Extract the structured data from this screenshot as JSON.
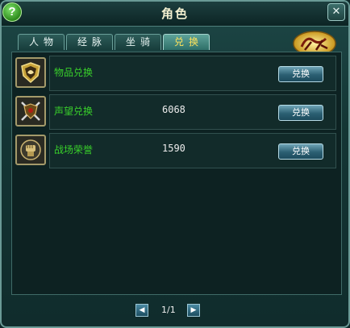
{
  "window": {
    "title": "角色"
  },
  "tabs": [
    {
      "label": "人物"
    },
    {
      "label": "经脉"
    },
    {
      "label": "坐骑"
    },
    {
      "label": "兑换",
      "active": true
    }
  ],
  "logo_icon": "battle-emblem-icon",
  "rows": [
    {
      "label": "物品兑换",
      "value": "",
      "button": "兑换",
      "icon": "item-shield-icon"
    },
    {
      "label": "声望兑换",
      "value": "6068",
      "button": "兑换",
      "icon": "crossed-swords-shield-icon"
    },
    {
      "label": "战场荣誉",
      "value": "1590",
      "button": "兑换",
      "icon": "fist-medal-icon"
    }
  ],
  "pager": {
    "text": "1/1"
  },
  "colors": {
    "label_green": "#39d12a",
    "active_tab_text": "#ffe35a"
  }
}
